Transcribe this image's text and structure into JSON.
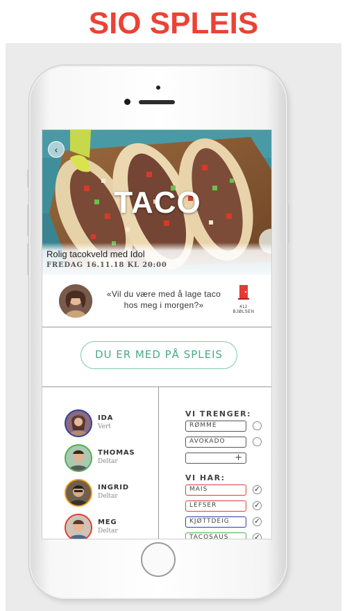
{
  "header": {
    "title": "SIO SPLEIS"
  },
  "event": {
    "hero_title": "TACO",
    "name": "Rolig tacokveld med Idol",
    "date": "FREDAG 16.11.18   KL 20:00",
    "back_icon": "chevron-left-icon"
  },
  "host": {
    "quote": "«Vil du være med å lage taco hos meg i morgen?»",
    "door_number": "412",
    "door_street": "BJØLSEN",
    "door_icon": "door-icon"
  },
  "cta": {
    "label": "DU ER MED PÅ SPLEIS",
    "color": "#79c9a6"
  },
  "participants": [
    {
      "name": "IDA",
      "role": "Vert",
      "ring_color": "#2b3f9e"
    },
    {
      "name": "THOMAS",
      "role": "Deltar",
      "ring_color": "#4caf50"
    },
    {
      "name": "INGRID",
      "role": "Deltar",
      "ring_color": "#f39c12"
    },
    {
      "name": "MEG",
      "role": "Deltar",
      "ring_color": "#e53935"
    }
  ],
  "needs": {
    "heading": "VI TRENGER:",
    "items": [
      "RØMME",
      "AVOKADO",
      ""
    ],
    "add_label": "+"
  },
  "haves": {
    "heading": "VI HAR:",
    "items": [
      {
        "label": "MAIS",
        "color": "#e53935",
        "checked": "✓"
      },
      {
        "label": "LEFSER",
        "color": "#e53935",
        "checked": "✓"
      },
      {
        "label": "KJØTTDEIG",
        "color": "#2b3f9e",
        "checked": "✓"
      },
      {
        "label": "TACOSAUS",
        "color": "#4caf50",
        "checked": "✓"
      }
    ]
  }
}
